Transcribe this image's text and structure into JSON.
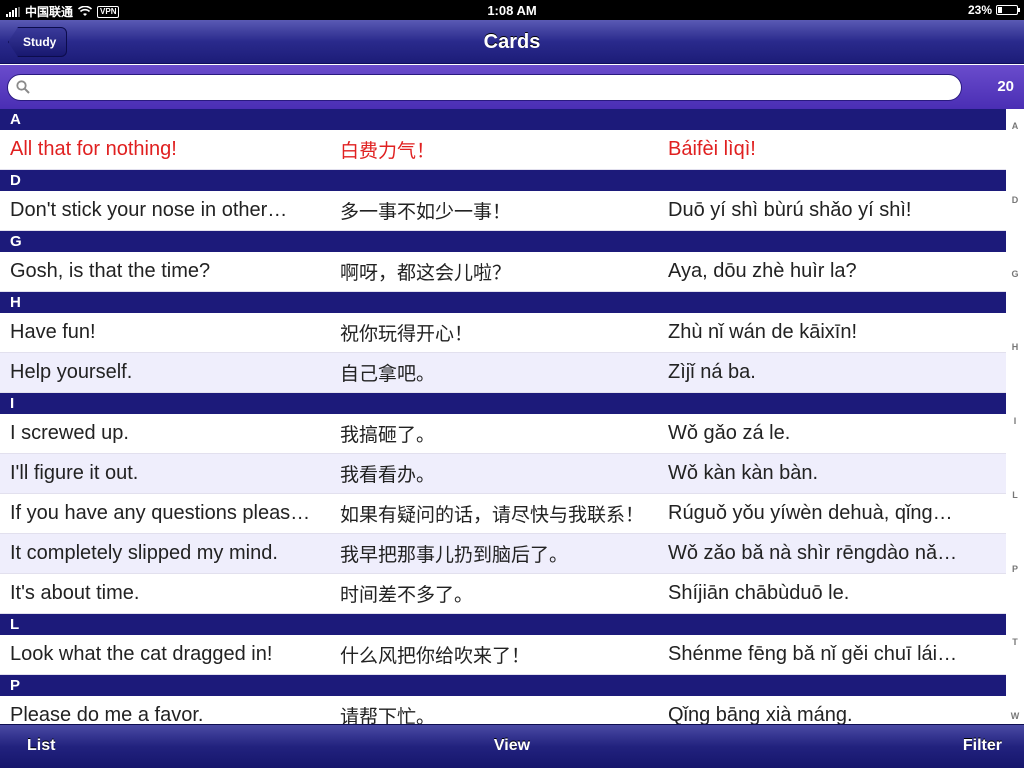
{
  "status_bar": {
    "carrier": "中国联通",
    "vpn": "VPN",
    "time": "1:08 AM",
    "battery": "23%"
  },
  "nav": {
    "back_label": "Study",
    "title": "Cards"
  },
  "search": {
    "placeholder": "",
    "value": "",
    "count": "20"
  },
  "sections": [
    {
      "letter": "A",
      "rows": [
        {
          "en": "All that for nothing!",
          "zh": "白费力气！",
          "py": "Báifèi lìqì!",
          "highlight": true
        }
      ]
    },
    {
      "letter": "D",
      "rows": [
        {
          "en": "Don't stick your nose in other…",
          "zh": "多一事不如少一事！",
          "py": "Duō yí shì bùrú shǎo yí shì!"
        }
      ]
    },
    {
      "letter": "G",
      "rows": [
        {
          "en": "Gosh, is that the time?",
          "zh": "啊呀，都这会儿啦？",
          "py": "Aya, dōu zhè huìr la?"
        }
      ]
    },
    {
      "letter": "H",
      "rows": [
        {
          "en": "Have fun!",
          "zh": "祝你玩得开心！",
          "py": "Zhù nǐ wán de kāixīn!"
        },
        {
          "en": "Help yourself.",
          "zh": "自己拿吧。",
          "py": "Zìjǐ ná ba."
        }
      ]
    },
    {
      "letter": "I",
      "rows": [
        {
          "en": "I screwed up.",
          "zh": "我搞砸了。",
          "py": "Wǒ gǎo zá le."
        },
        {
          "en": "I'll figure it out.",
          "zh": "我看看办。",
          "py": "Wǒ kàn kàn bàn."
        },
        {
          "en": "If you have any questions pleas…",
          "zh": "如果有疑问的话，请尽快与我联系！",
          "py": "Rúguǒ yǒu yíwèn dehuà, qǐng…"
        },
        {
          "en": "It completely slipped my mind.",
          "zh": "我早把那事儿扔到脑后了。",
          "py": "Wǒ zǎo bǎ nà shìr rēngdào nǎ…"
        },
        {
          "en": "It's about time.",
          "zh": "时间差不多了。",
          "py": "Shíjiān chābùduō le."
        }
      ]
    },
    {
      "letter": "L",
      "rows": [
        {
          "en": "Look what the cat dragged in!",
          "zh": "什么风把你给吹来了！",
          "py": "Shénme fēng bǎ nǐ gěi chuī lái…"
        }
      ]
    },
    {
      "letter": "P",
      "rows": [
        {
          "en": "Please do me a favor.",
          "zh": "请帮下忙。",
          "py": "Qǐng bāng xià máng."
        }
      ]
    }
  ],
  "index_letters": [
    "A",
    "D",
    "G",
    "H",
    "I",
    "L",
    "P",
    "T",
    "W"
  ],
  "toolbar": {
    "list_label": "List",
    "view_label": "View",
    "filter_label": "Filter"
  },
  "colors": {
    "section_header": "#1c1a7a",
    "highlight_text": "#e02020",
    "alt_row": "#efeefc"
  }
}
